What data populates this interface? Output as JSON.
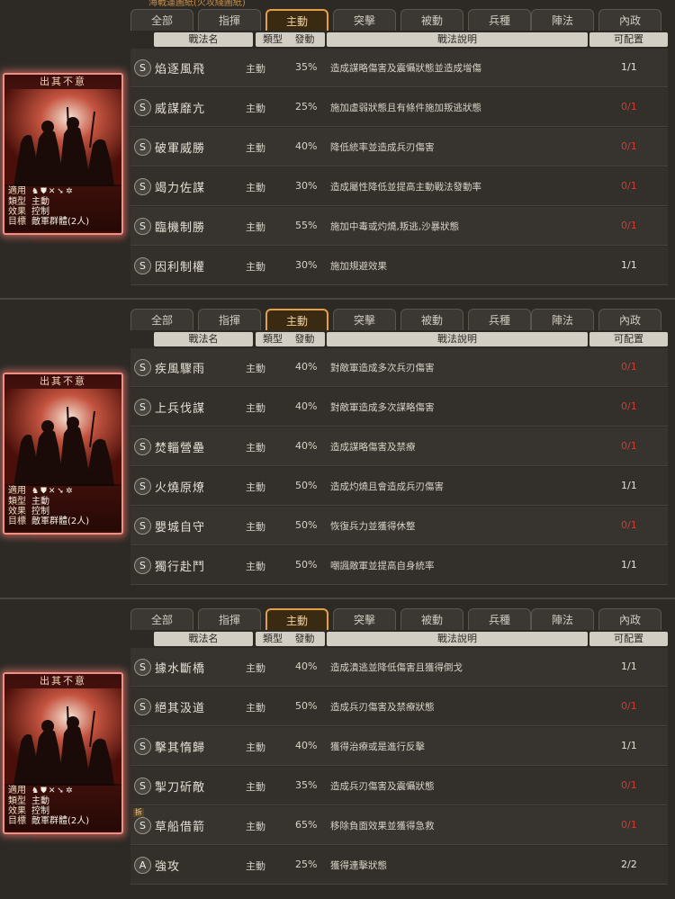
{
  "top_strip": "海戰運圖紙(火攻綫圖紙)",
  "tabs": [
    "全部",
    "指揮",
    "主動",
    "突擊",
    "被動",
    "兵種",
    "陣法",
    "內政"
  ],
  "headers": {
    "name": "戰法名",
    "type": "類型",
    "rate": "發動",
    "desc": "戰法說明",
    "slot": "可配置"
  },
  "card": {
    "title": "出其不意",
    "applies_label": "適用",
    "type_label": "類型",
    "type_value": "主動",
    "effect_label": "效果",
    "effect_value": "控制",
    "target_label": "目標",
    "target_value": "敵軍群體(2人)",
    "unit_icons": [
      "cavalry-icon",
      "shield-icon",
      "bow-icon",
      "spear-icon",
      "wheel-icon"
    ]
  },
  "panels": [
    {
      "rows": [
        {
          "grade": "S",
          "name": "焰逐風飛",
          "type": "主動",
          "rate": "35%",
          "desc": "造成謀略傷害及震懾狀態並造成增傷",
          "slot": "1/1",
          "red": false
        },
        {
          "grade": "S",
          "name": "威謀靡亢",
          "type": "主動",
          "rate": "25%",
          "desc": "施加虛弱狀態且有條件施加叛逃狀態",
          "slot": "0/1",
          "red": true
        },
        {
          "grade": "S",
          "name": "破軍威勝",
          "type": "主動",
          "rate": "40%",
          "desc": "降低統率並造成兵刃傷害",
          "slot": "0/1",
          "red": true
        },
        {
          "grade": "S",
          "name": "竭力佐謀",
          "type": "主動",
          "rate": "30%",
          "desc": "造成屬性降低並提高主動戰法發動率",
          "slot": "0/1",
          "red": true
        },
        {
          "grade": "S",
          "name": "臨機制勝",
          "type": "主動",
          "rate": "55%",
          "desc": "施加中毒或灼燒,叛逃,沙暴狀態",
          "slot": "0/1",
          "red": true
        },
        {
          "grade": "S",
          "name": "因利制權",
          "type": "主動",
          "rate": "30%",
          "desc": "施加規避效果",
          "slot": "1/1",
          "red": false
        }
      ]
    },
    {
      "rows": [
        {
          "grade": "S",
          "name": "疾風驟雨",
          "type": "主動",
          "rate": "40%",
          "desc": "對敵軍造成多次兵刃傷害",
          "slot": "0/1",
          "red": true
        },
        {
          "grade": "S",
          "name": "上兵伐謀",
          "type": "主動",
          "rate": "40%",
          "desc": "對敵軍造成多次謀略傷害",
          "slot": "0/1",
          "red": true
        },
        {
          "grade": "S",
          "name": "焚輜營壘",
          "type": "主動",
          "rate": "40%",
          "desc": "造成謀略傷害及禁療",
          "slot": "0/1",
          "red": true
        },
        {
          "grade": "S",
          "name": "火燒原燎",
          "type": "主動",
          "rate": "50%",
          "desc": "造成灼燒且會造成兵刃傷害",
          "slot": "1/1",
          "red": false
        },
        {
          "grade": "S",
          "name": "嬰城自守",
          "type": "主動",
          "rate": "50%",
          "desc": "恢復兵力並獲得休整",
          "slot": "0/1",
          "red": true
        },
        {
          "grade": "S",
          "name": "獨行赴鬥",
          "type": "主動",
          "rate": "50%",
          "desc": "嘲諷敵軍並提高自身統率",
          "slot": "1/1",
          "red": false
        }
      ]
    },
    {
      "rows": [
        {
          "grade": "S",
          "name": "據水斷橋",
          "type": "主動",
          "rate": "40%",
          "desc": "造成潰逃並降低傷害且獲得倒戈",
          "slot": "1/1",
          "red": false
        },
        {
          "grade": "S",
          "name": "絕其汲道",
          "type": "主動",
          "rate": "50%",
          "desc": "造成兵刃傷害及禁療狀態",
          "slot": "0/1",
          "red": true
        },
        {
          "grade": "S",
          "name": "擊其惰歸",
          "type": "主動",
          "rate": "40%",
          "desc": "獲得治療或是進行反擊",
          "slot": "1/1",
          "red": false
        },
        {
          "grade": "S",
          "name": "掣刀斫敵",
          "type": "主動",
          "rate": "35%",
          "desc": "造成兵刃傷害及震懾狀態",
          "slot": "0/1",
          "red": true
        },
        {
          "grade": "S",
          "name": "草船借箭",
          "type": "主動",
          "rate": "65%",
          "desc": "移除負面效果並獲得急救",
          "slot": "0/1",
          "red": true
        },
        {
          "grade": "A",
          "name": "強攻",
          "type": "主動",
          "rate": "25%",
          "desc": "獲得連擊狀態",
          "slot": "2/2",
          "red": false
        }
      ]
    }
  ],
  "small_tag": "拆"
}
